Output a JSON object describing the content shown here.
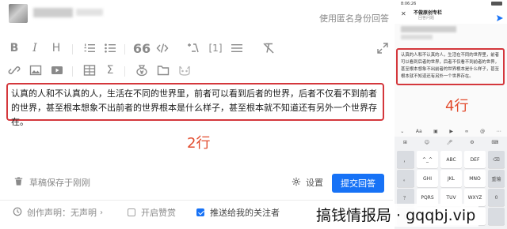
{
  "header": {
    "anonymous_link": "使用匿名身份回答"
  },
  "editor": {
    "body_text": "认真的人和不认真的人，生活在不同的世界里，前者可以看到后者的世界，后者不仅看不到前者的世界，甚至根本想象不出前者的世界根本是什么样子，甚至根本就不知道还有另外一个世界存在。"
  },
  "annotations": {
    "left_rows": "2行",
    "right_rows": "4行"
  },
  "footer": {
    "draft_status": "草稿保存于刚刚",
    "settings_label": "设置",
    "submit_label": "提交回答",
    "creation_statement": "创作声明：无声明",
    "enable_tips": "开启赞赏",
    "push_followers": "推送给我的关注者",
    "push_followers_checked": true,
    "enable_tips_checked": false,
    "accent_color": "#1772f6",
    "highlight_color": "#d4373c"
  },
  "phone": {
    "status_time": "8:06:26",
    "title": "不做原创专栏",
    "subtitle": "回答问题",
    "body_text": "认真的人和不认真的人，生活在不同的世界里，前者可以看到后者的世界，后者不仅看不到前者的世界，甚至根本想象不出前者的世界根本是什么样子，甚至根本就不知道还有另外一个世界存在。",
    "keyboard": {
      "toolbar": [
        "Aa"
      ],
      "rows": [
        [
          "",
          "^_^",
          "ABC",
          "DEF",
          "⌫"
        ],
        [
          "",
          "GHI",
          "JKL",
          "MNO",
          "重输"
        ],
        [
          "",
          "PQRS",
          "TUV",
          "WXYZ",
          "0"
        ]
      ],
      "left_column": [
        "，",
        "。",
        "？",
        "！"
      ]
    }
  },
  "watermark": "搞钱情报局 · gqqbj.vip"
}
